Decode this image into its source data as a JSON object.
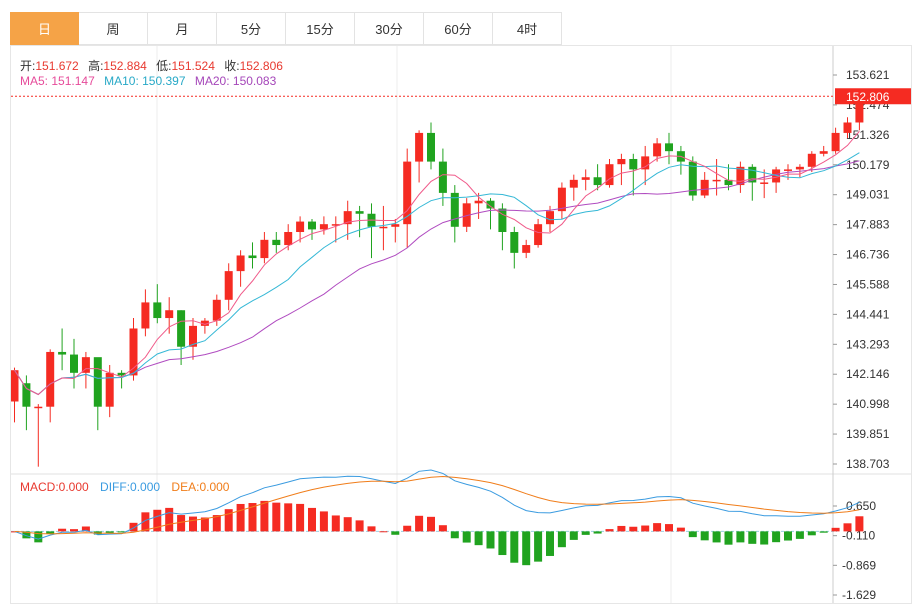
{
  "tabs": [
    {
      "label": "日",
      "active": true
    },
    {
      "label": "周",
      "active": false
    },
    {
      "label": "月",
      "active": false
    },
    {
      "label": "5分",
      "active": false
    },
    {
      "label": "15分",
      "active": false
    },
    {
      "label": "30分",
      "active": false
    },
    {
      "label": "60分",
      "active": false
    },
    {
      "label": "4时",
      "active": false
    }
  ],
  "ohlc_info": {
    "open_label": "开:",
    "open": "151.672",
    "high_label": "高:",
    "high": "152.884",
    "low_label": "低:",
    "low": "151.524",
    "close_label": "收:",
    "close": "152.806"
  },
  "ma_info": {
    "ma5_label": "MA5:",
    "ma5": "151.147",
    "ma10_label": "MA10:",
    "ma10": "150.397",
    "ma20_label": "MA20:",
    "ma20": "150.083"
  },
  "macd_info": {
    "macd_label": "MACD:",
    "macd": "0.000",
    "diff_label": "DIFF:",
    "diff": "0.000",
    "dea_label": "DEA:",
    "dea": "0.000"
  },
  "colors": {
    "up": "#f52b22",
    "down": "#20a31f",
    "ma5": "#f05a8a",
    "ma10": "#35b8d6",
    "ma20": "#b04bc0",
    "diff": "#3a9be0",
    "dea": "#f07d1a",
    "label_red": "#e8392f",
    "label_pink": "#e64b9a",
    "label_cyan": "#28a9c7",
    "label_purple": "#a546b9",
    "price_tag": "#f52b22"
  },
  "chart_data": {
    "type": "candlestick",
    "last_price_tag": 152.806,
    "price_axis": {
      "ylim": [
        138.703,
        153.621
      ],
      "ticks": [
        "153.621",
        "152.474",
        "151.326",
        "150.179",
        "149.031",
        "147.883",
        "146.736",
        "145.588",
        "144.441",
        "143.293",
        "142.146",
        "140.998",
        "139.851",
        "138.703"
      ]
    },
    "macd_axis": {
      "ylim": [
        -1.629,
        0.65
      ],
      "ticks": [
        "0.650",
        "-0.110",
        "-0.869",
        "-1.629"
      ]
    },
    "candles": [
      [
        142.1,
        142.0,
        141.9,
        140.9,
        142.3,
        140.3,
        142.4
      ],
      [
        142.7,
        142.0,
        140.8,
        140.0,
        140.8,
        140.5,
        140.0
      ],
      [
        142.8,
        143.0,
        142.1,
        141.8,
        142.5,
        142.2,
        143.4
      ],
      [
        142.9,
        143.5,
        143.0,
        143.1,
        143.0,
        143.2,
        143.0
      ],
      [
        142.3,
        141.5,
        141.3,
        140.5,
        142.1,
        142.1,
        140.5
      ],
      [
        143.3,
        143.0,
        142.0,
        142.0,
        141.8,
        142.0,
        142.5
      ],
      [
        138.5,
        140.2,
        140.6,
        140.3,
        140.3,
        140.7,
        141.0
      ],
      [
        142.0,
        142.7,
        142.8,
        144.3,
        145.2,
        144.2,
        144.7
      ],
      [
        140.7,
        142.9,
        142.5,
        144.8,
        144.0,
        143.5,
        144.1
      ],
      [
        140.5,
        139.0,
        141.1,
        141.2,
        143.3,
        145.5,
        144.3
      ],
      [
        141.4,
        143.3,
        140.3,
        141.1,
        143.0,
        143.2,
        143.9
      ],
      [
        140.3,
        141.7,
        140.2,
        140.3,
        142.1,
        143.4,
        144.0
      ]
    ],
    "ma5": [],
    "ma10": [],
    "ma20": [],
    "macd_hist": [],
    "diff": [],
    "dea": []
  }
}
